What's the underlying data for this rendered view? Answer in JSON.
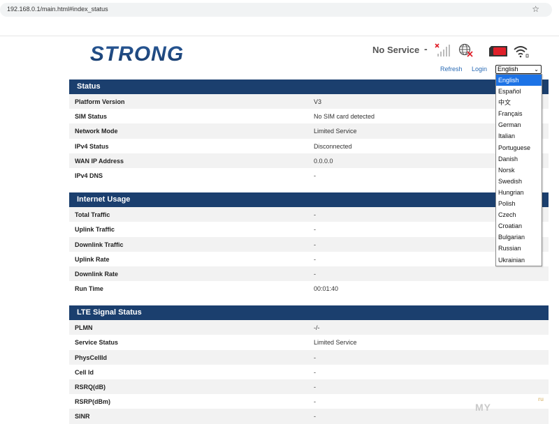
{
  "browser": {
    "url": "192.168.0.1/main.html#index_status",
    "bookmark_icon": "star-icon"
  },
  "header": {
    "logo_text": "STRONG",
    "service_status": "No Service",
    "separator": "-",
    "refresh_label": "Refresh",
    "login_label": "Login",
    "language_selected": "English",
    "colors": {
      "brand": "#1b3f6e",
      "link": "#2a6bb5",
      "sim": "#e0202a",
      "select_highlight": "#1d73e6"
    }
  },
  "status": {
    "title": "Status",
    "rows": [
      {
        "label": "Platform Version",
        "value": "V3"
      },
      {
        "label": "SIM Status",
        "value": "No SIM card detected"
      },
      {
        "label": "Network Mode",
        "value": "Limited Service"
      },
      {
        "label": "IPv4 Status",
        "value": "Disconnected"
      },
      {
        "label": "WAN IP Address",
        "value": "0.0.0.0"
      },
      {
        "label": "IPv4 DNS",
        "value": "-"
      }
    ]
  },
  "internet_usage": {
    "title": "Internet Usage",
    "rows": [
      {
        "label": "Total Traffic",
        "value": "-"
      },
      {
        "label": "Uplink Traffic",
        "value": "-"
      },
      {
        "label": "Downlink Traffic",
        "value": "-"
      },
      {
        "label": "Uplink Rate",
        "value": "-"
      },
      {
        "label": "Downlink Rate",
        "value": "-"
      },
      {
        "label": "Run Time",
        "value": "00:01:40"
      }
    ]
  },
  "lte_signal": {
    "title": "LTE Signal Status",
    "rows": [
      {
        "label": "PLMN",
        "value": "-/-"
      },
      {
        "label": "Service Status",
        "value": "Limited Service"
      },
      {
        "label": "PhysCellId",
        "value": "-"
      },
      {
        "label": "Cell Id",
        "value": "-"
      },
      {
        "label": "RSRQ(dB)",
        "value": "-"
      },
      {
        "label": "RSRP(dBm)",
        "value": "-"
      },
      {
        "label": "SINR",
        "value": "-"
      }
    ]
  },
  "language_options": [
    "English",
    "Español",
    "中文",
    "Français",
    "German",
    "Italian",
    "Portuguese",
    "Danish",
    "Norsk",
    "Swedish",
    "Hungrian",
    "Polish",
    "Czech",
    "Croatian",
    "Bulgarian",
    "Russian",
    "Ukrainian"
  ],
  "watermark": {
    "text": "MY",
    "small": "ru"
  }
}
